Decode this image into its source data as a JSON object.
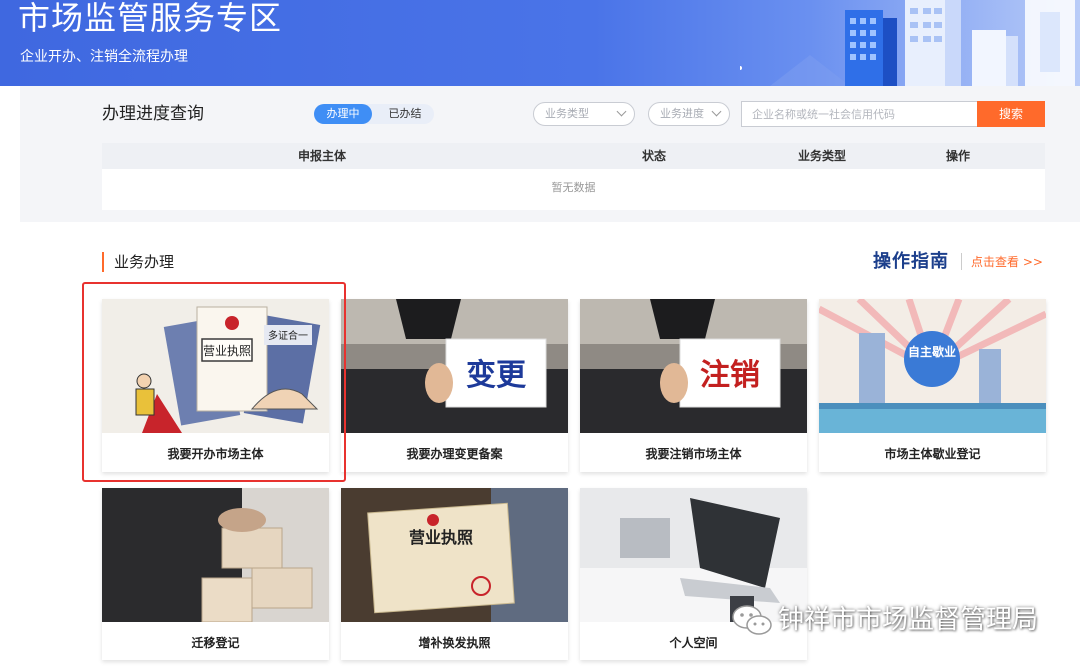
{
  "banner": {
    "title": "市场监管服务专区",
    "subtitle": "企业开办、注销全流程办理"
  },
  "progress_query": {
    "title": "办理进度查询",
    "tabs": [
      {
        "label": "办理中",
        "active": true
      },
      {
        "label": "已办结",
        "active": false
      }
    ],
    "filters": {
      "business_type_placeholder": "业务类型",
      "business_progress_placeholder": "业务进度"
    },
    "search": {
      "placeholder": "企业名称或统一社会信用代码",
      "button_label": "搜索"
    },
    "table": {
      "columns": [
        "申报主体",
        "状态",
        "业务类型",
        "操作"
      ],
      "empty_text": "暂无数据"
    }
  },
  "business": {
    "section_title": "业务办理",
    "guide_title": "操作指南",
    "guide_link": "点击查看 >>",
    "cards": [
      {
        "label": "我要开办市场主体",
        "image_text": [
          "营业执照",
          "多证合一"
        ],
        "highlighted": true
      },
      {
        "label": "我要办理变更备案",
        "image_text": [
          "变更"
        ]
      },
      {
        "label": "我要注销市场主体",
        "image_text": [
          "注销"
        ]
      },
      {
        "label": "市场主体歇业登记",
        "image_text": [
          "自主歇业"
        ]
      },
      {
        "label": "迁移登记",
        "image_text": []
      },
      {
        "label": "增补换发执照",
        "image_text": [
          "营业执照"
        ]
      },
      {
        "label": "个人空间",
        "image_text": []
      }
    ]
  },
  "watermark": {
    "text": "钟祥市市场监督管理局",
    "icon": "wechat-icon"
  },
  "colors": {
    "banner_blue": "#4a74e8",
    "accent_orange": "#ff6a2b",
    "tab_active_blue": "#3f8ef5",
    "guide_navy": "#1c3f8c",
    "highlight_red": "#e8322f"
  }
}
